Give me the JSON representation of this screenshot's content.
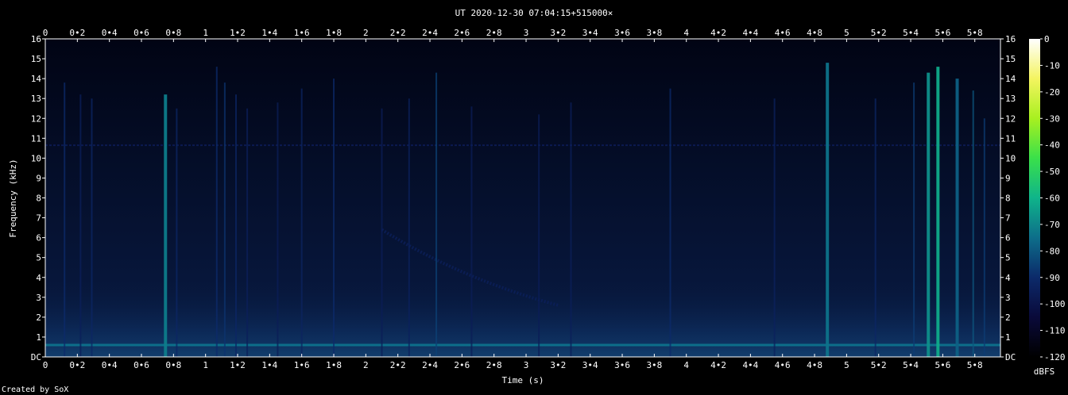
{
  "title": "UT 2020-12-30 07:04:15+515000×",
  "credit": "Created by SoX",
  "colorbar_unit": "dBFS",
  "chart_data": {
    "type": "heatmap",
    "title": "UT 2020-12-30 07:04:15+515000×",
    "xlabel": "Time (s)",
    "ylabel": "Frequency (kHz)",
    "xlim": [
      0,
      5.96
    ],
    "ylim": [
      0,
      16
    ],
    "x_ticks": [
      "0",
      "0•2",
      "0•4",
      "0•6",
      "0•8",
      "1",
      "1•2",
      "1•4",
      "1•6",
      "1•8",
      "2",
      "2•2",
      "2•4",
      "2•6",
      "2•8",
      "3",
      "3•2",
      "3•4",
      "3•6",
      "3•8",
      "4",
      "4•2",
      "4•4",
      "4•6",
      "4•8",
      "5",
      "5•2",
      "5•4",
      "5•6",
      "5•8"
    ],
    "y_ticks": [
      "DC",
      "1",
      "2",
      "3",
      "4",
      "5",
      "6",
      "7",
      "8",
      "9",
      "10",
      "11",
      "12",
      "13",
      "14",
      "15",
      "16"
    ],
    "colorbar": {
      "label": "dBFS",
      "range": [
        -120,
        0
      ],
      "ticks": [
        "0",
        "-10",
        "-20",
        "-30",
        "-40",
        "-50",
        "-60",
        "-70",
        "-80",
        "-90",
        "-100",
        "-110",
        "-120"
      ],
      "colors": [
        "#000000",
        "#0a0a3a",
        "#0c2a6a",
        "#0d6e8a",
        "#0fb48a",
        "#3ae04a",
        "#a8f020",
        "#f4f460",
        "#ffffff"
      ]
    },
    "background_dbfs": -105,
    "broadband_noise_floor_khz": [
      0,
      4
    ],
    "tone_lines": [
      {
        "freq_khz": 0.6,
        "t_start": 0,
        "t_end": 5.96,
        "level_dbfs": -75
      },
      {
        "freq_khz": 10.65,
        "t_start": 0,
        "t_end": 5.96,
        "level_dbfs": -98
      }
    ],
    "transients": [
      {
        "t": 0.12,
        "f_top_khz": 13.8,
        "level_dbfs": -90
      },
      {
        "t": 0.22,
        "f_top_khz": 13.2,
        "level_dbfs": -95
      },
      {
        "t": 0.29,
        "f_top_khz": 13.0,
        "level_dbfs": -92
      },
      {
        "t": 0.75,
        "f_top_khz": 13.2,
        "level_dbfs": -72
      },
      {
        "t": 0.82,
        "f_top_khz": 12.5,
        "level_dbfs": -92
      },
      {
        "t": 1.07,
        "f_top_khz": 14.6,
        "level_dbfs": -90
      },
      {
        "t": 1.12,
        "f_top_khz": 13.8,
        "level_dbfs": -88
      },
      {
        "t": 1.19,
        "f_top_khz": 13.2,
        "level_dbfs": -92
      },
      {
        "t": 1.26,
        "f_top_khz": 12.5,
        "level_dbfs": -95
      },
      {
        "t": 1.45,
        "f_top_khz": 12.8,
        "level_dbfs": -96
      },
      {
        "t": 1.6,
        "f_top_khz": 13.5,
        "level_dbfs": -93
      },
      {
        "t": 1.8,
        "f_top_khz": 14.0,
        "level_dbfs": -90
      },
      {
        "t": 2.1,
        "f_top_khz": 12.5,
        "level_dbfs": -96
      },
      {
        "t": 2.27,
        "f_top_khz": 13.0,
        "level_dbfs": -94
      },
      {
        "t": 2.44,
        "f_top_khz": 14.3,
        "level_dbfs": -85
      },
      {
        "t": 2.66,
        "f_top_khz": 12.6,
        "level_dbfs": -96
      },
      {
        "t": 3.08,
        "f_top_khz": 12.2,
        "level_dbfs": -96
      },
      {
        "t": 3.28,
        "f_top_khz": 12.8,
        "level_dbfs": -95
      },
      {
        "t": 3.9,
        "f_top_khz": 13.5,
        "level_dbfs": -90
      },
      {
        "t": 4.55,
        "f_top_khz": 13.0,
        "level_dbfs": -94
      },
      {
        "t": 4.88,
        "f_top_khz": 14.8,
        "level_dbfs": -74
      },
      {
        "t": 5.18,
        "f_top_khz": 13.0,
        "level_dbfs": -92
      },
      {
        "t": 5.42,
        "f_top_khz": 13.8,
        "level_dbfs": -86
      },
      {
        "t": 5.51,
        "f_top_khz": 14.3,
        "level_dbfs": -68
      },
      {
        "t": 5.57,
        "f_top_khz": 14.6,
        "level_dbfs": -62
      },
      {
        "t": 5.69,
        "f_top_khz": 14.0,
        "level_dbfs": -78
      },
      {
        "t": 5.79,
        "f_top_khz": 13.4,
        "level_dbfs": -80
      },
      {
        "t": 5.86,
        "f_top_khz": 12.0,
        "level_dbfs": -86
      }
    ],
    "chirp": {
      "t_start": 2.1,
      "f_start_khz": 6.4,
      "t_end": 3.2,
      "f_end_khz": 2.6,
      "level_dbfs": -95
    }
  }
}
